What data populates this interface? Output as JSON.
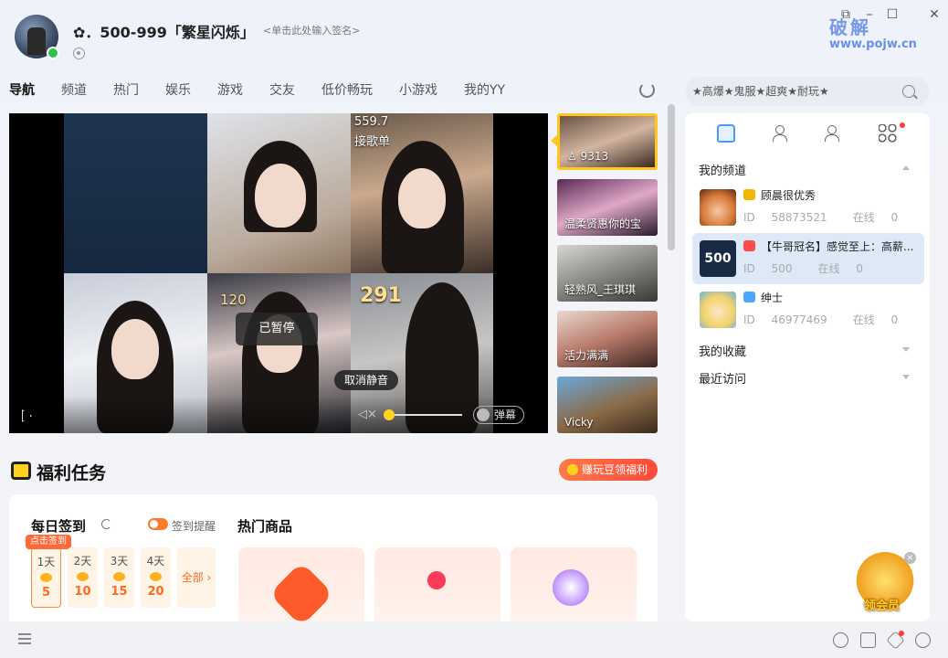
{
  "header": {
    "user_name": "✿．500-999「繁星闪烁」",
    "signature_placeholder": "<单击此处输入签名>",
    "watermark_title": "破解",
    "watermark_url": "www.pojw.cn"
  },
  "window_controls": [
    "⧉",
    "–",
    "☐",
    "✕"
  ],
  "nav": {
    "tabs": [
      "导航",
      "频道",
      "热门",
      "娱乐",
      "游戏",
      "交友",
      "低价畅玩",
      "小游戏",
      "我的YY"
    ],
    "active": 0
  },
  "player": {
    "cell_numbers": [
      "559.7",
      "120",
      "291"
    ],
    "song_label": "接歌单",
    "paused_text": "已暂停",
    "unmute_tip": "取消静音",
    "volume": 0.05,
    "danmaku_label": "弹幕"
  },
  "thumbs": [
    {
      "label": "9313",
      "active": true
    },
    {
      "label": "温柔贤惠你的宝",
      "active": false
    },
    {
      "label": "轻熟风_王琪琪",
      "active": false
    },
    {
      "label": "活力满满",
      "active": false
    },
    {
      "label": "Vicky",
      "active": false
    }
  ],
  "welfare": {
    "title": "福利任务",
    "earn_button": "赚玩豆领福利",
    "checkin_title": "每日签到",
    "remind_label": "签到提醒",
    "checkin_badge": "点击签到",
    "days": [
      {
        "label": "1天",
        "value": "5"
      },
      {
        "label": "2天",
        "value": "10"
      },
      {
        "label": "3天",
        "value": "15"
      },
      {
        "label": "4天",
        "value": "20"
      }
    ],
    "all_link": "全部 ›",
    "hot_title": "热门商品"
  },
  "search": {
    "value": "★高爆★鬼服★超爽★耐玩★"
  },
  "panel": {
    "my_channels": "我的频道",
    "channels": [
      {
        "name": "顾晨很优秀",
        "id_label": "ID",
        "id": "58873521",
        "online_label": "在线",
        "online": "0",
        "badge_color": "#f5b400",
        "selected": false
      },
      {
        "name": "【牛哥冠名】感觉至上：高薪...",
        "id_label": "ID",
        "id": "500",
        "online_label": "在线",
        "online": "0",
        "badge_color": "#ff4a4a",
        "selected": true
      },
      {
        "name": "绅士",
        "id_label": "ID",
        "id": "46977469",
        "online_label": "在线",
        "online": "0",
        "badge_color": "#4aa6ff",
        "selected": false
      }
    ],
    "my_favorites": "我的收藏",
    "recent_visits": "最近访问",
    "vip_text": "领会员"
  },
  "colors": {
    "accent": "#4a9af5",
    "orange": "#ff6a1e",
    "yellow": "#ffd21e"
  }
}
